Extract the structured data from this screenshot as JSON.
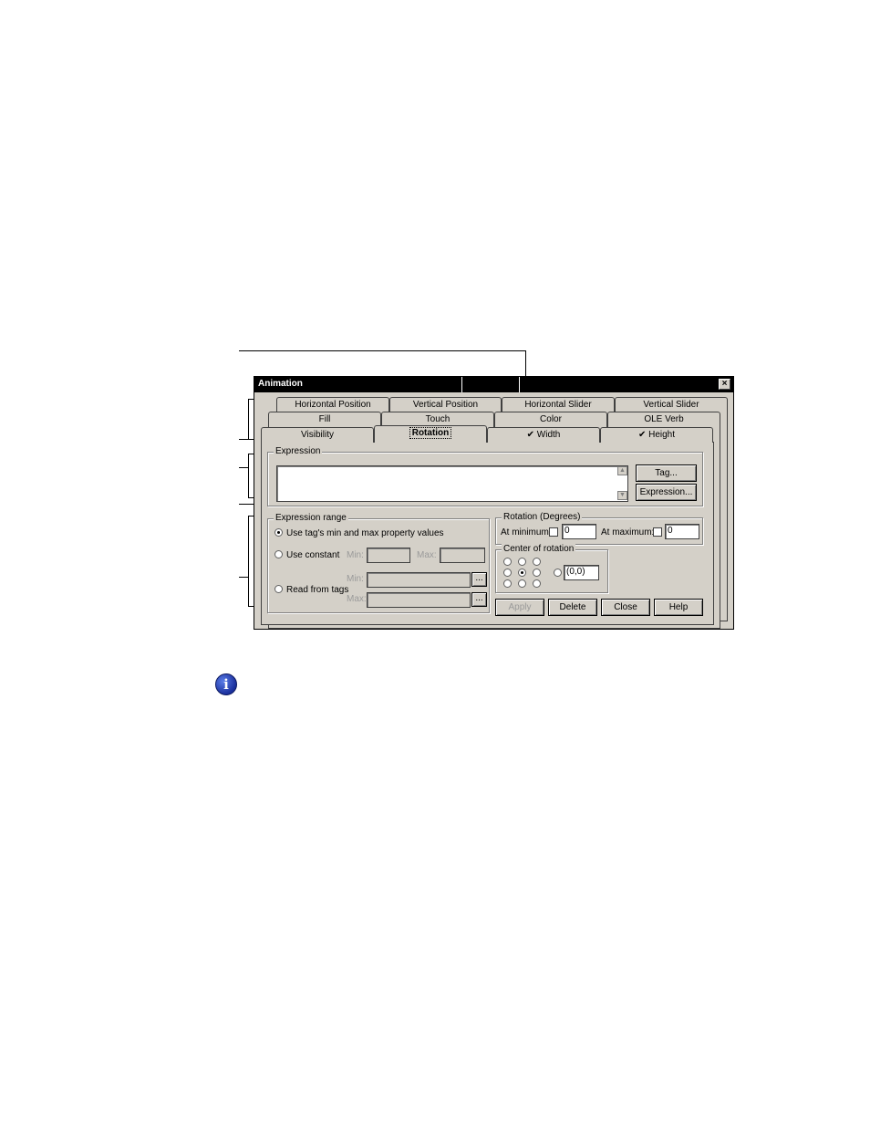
{
  "window": {
    "title": "Animation",
    "close_glyph": "×"
  },
  "tabs": {
    "row1": [
      "Horizontal Position",
      "Vertical Position",
      "Horizontal Slider",
      "Vertical Slider"
    ],
    "row2": [
      "Fill",
      "Touch",
      "Color",
      "OLE Verb"
    ],
    "row3": [
      "Visibility",
      "Rotation",
      "✔ Width",
      "✔ Height"
    ],
    "active": "Rotation"
  },
  "expression": {
    "group_title": "Expression",
    "value": "",
    "tag_button": "Tag...",
    "expression_button": "Expression..."
  },
  "expression_range": {
    "group_title": "Expression range",
    "option_tag_minmax": "Use tag's min and max property values",
    "option_constant": "Use constant",
    "option_read_tags": "Read from tags",
    "selected": "option_tag_minmax",
    "min_label": "Min:",
    "max_label": "Max:",
    "browse": "..."
  },
  "rotation": {
    "group_title": "Rotation (Degrees)",
    "at_minimum_label": "At minimum:",
    "at_minimum_value": "0",
    "at_maximum_label": "At maximum:",
    "at_maximum_value": "0"
  },
  "center": {
    "group_title": "Center of rotation",
    "selected": "middle-center",
    "custom_value": "(0,0)"
  },
  "buttons": {
    "apply": "Apply",
    "delete": "Delete",
    "close": "Close",
    "help": "Help"
  },
  "icons": {
    "info": "i"
  }
}
